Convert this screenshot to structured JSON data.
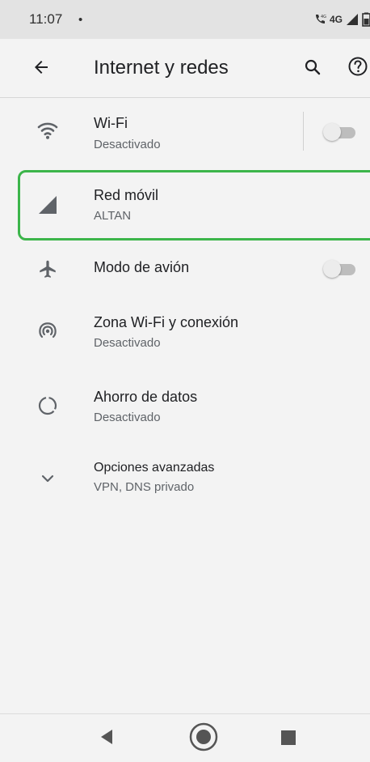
{
  "status_bar": {
    "time": "11:07",
    "dot": "•",
    "network_label": "4G"
  },
  "app_bar": {
    "title": "Internet y redes"
  },
  "items": [
    {
      "title": "Wi-Fi",
      "subtitle": "Desactivado",
      "icon": "wifi-icon",
      "toggle": false
    },
    {
      "title": "Red móvil",
      "subtitle": "ALTAN",
      "icon": "signal-icon"
    },
    {
      "title": "Modo de avión",
      "icon": "airplane-icon",
      "toggle": false
    },
    {
      "title": "Zona Wi-Fi y conexión",
      "subtitle": "Desactivado",
      "icon": "hotspot-icon"
    },
    {
      "title": "Ahorro de datos",
      "subtitle": "Desactivado",
      "icon": "data-saver-icon"
    },
    {
      "title": "Opciones avanzadas",
      "subtitle": "VPN, DNS privado",
      "icon": "chevron-down-icon"
    }
  ],
  "colors": {
    "highlight": "#3cb54a",
    "background": "#f3f3f3",
    "status_bar": "#e3e3e3"
  }
}
